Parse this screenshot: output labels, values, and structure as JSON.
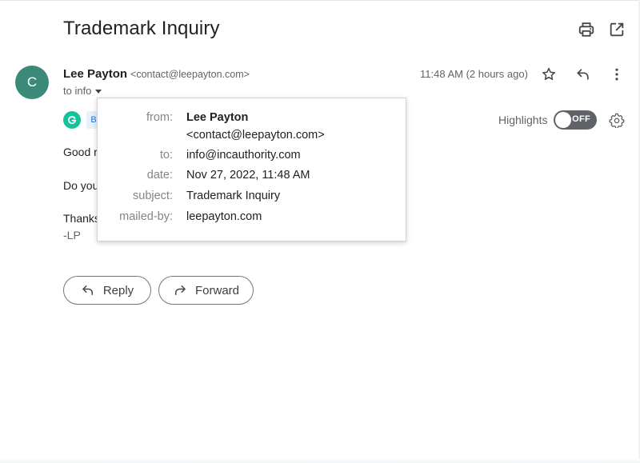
{
  "email": {
    "subject": "Trademark Inquiry",
    "avatar_letter": "C",
    "sender_name": "Lee Payton",
    "sender_email": "<contact@leepayton.com>",
    "to_line": "to info",
    "timestamp": "11:48 AM (2 hours ago)",
    "body": {
      "greeting": "Good r",
      "question": "Do you",
      "thanks": "Thanks",
      "signature": "-LP"
    }
  },
  "addons": {
    "grammarly_badge": "B",
    "highlights_label": "Highlights",
    "toggle_state": "OFF"
  },
  "details_popup": {
    "from_label": "from:",
    "from_name": "Lee Payton",
    "from_email": "<contact@leepayton.com>",
    "to_label": "to:",
    "to_value": "info@incauthority.com",
    "date_label": "date:",
    "date_value": "Nov 27, 2022, 11:48 AM",
    "subject_label": "subject:",
    "subject_value": "Trademark Inquiry",
    "mailed_by_label": "mailed-by:",
    "mailed_by_value": "leepayton.com"
  },
  "actions": {
    "reply_label": "Reply",
    "forward_label": "Forward"
  },
  "icons": {
    "print": "print-icon",
    "open_new_window": "open-in-new-window-icon",
    "star": "star-icon",
    "reply": "reply-arrow-icon",
    "more": "more-vertical-icon",
    "settings": "gear-icon",
    "grammarly": "grammarly-icon",
    "forward": "forward-arrow-icon"
  },
  "colors": {
    "avatar_bg": "#3b8a77",
    "grammarly_green": "#15c39a",
    "toggle_bg": "#5f6368"
  }
}
